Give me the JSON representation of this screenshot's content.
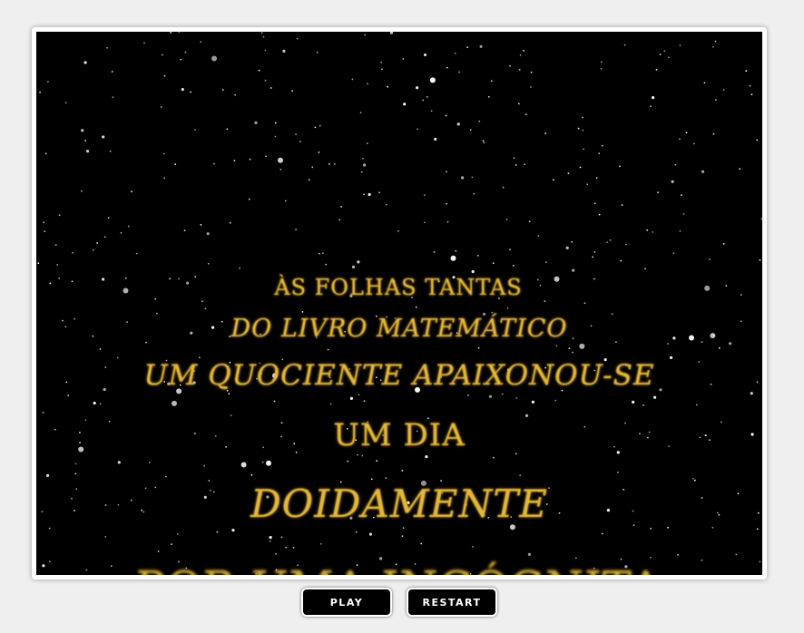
{
  "crawl": {
    "lines": [
      "ÀS FOLHAS TANTAS",
      "DO LIVRO MATEMÁTICO",
      "UM QUOCIENTE APAIXONOU-SE",
      "UM DIA",
      "DOIDAMENTE",
      "POR UMA INCÓGNITA"
    ],
    "text_color": "#e3b83a",
    "background": "#000000"
  },
  "controls": {
    "play_label": "PLAY",
    "restart_label": "RESTART"
  }
}
